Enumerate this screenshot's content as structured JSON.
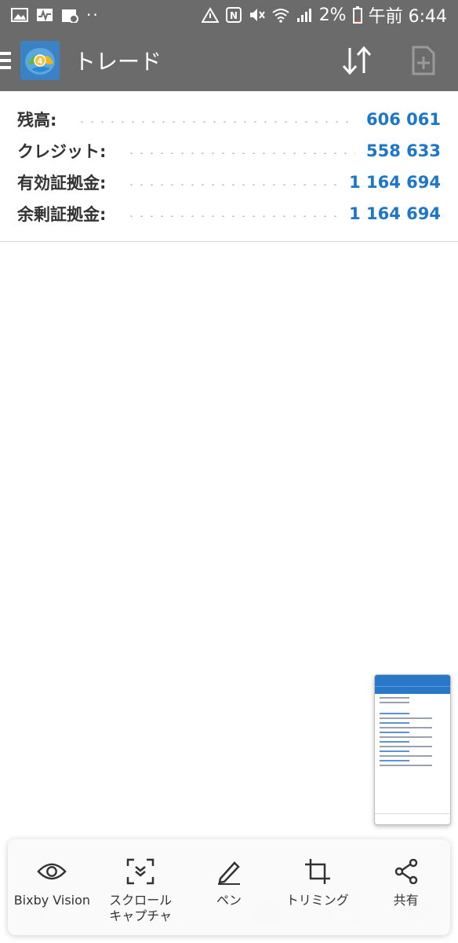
{
  "status_bar": {
    "battery": "2%",
    "time": "午前 6:44",
    "left_icons": [
      "image-icon",
      "activity-icon",
      "calendar-icon",
      "more-dots-icon"
    ],
    "right_icons": [
      "alert-icon",
      "nfc-icon",
      "mute-icon",
      "wifi-icon",
      "signal-icon",
      "battery-icon"
    ]
  },
  "app_bar": {
    "title": "トレード",
    "logo": "metatrader-4-logo",
    "actions": [
      "sort-icon",
      "new-order-icon"
    ]
  },
  "account": {
    "rows": [
      {
        "label": "残高:",
        "value": "606 061"
      },
      {
        "label": "クレジット:",
        "value": "558 633"
      },
      {
        "label": "有効証拠金:",
        "value": "1 164 694"
      },
      {
        "label": "余剰証拠金:",
        "value": "1 164 694"
      }
    ],
    "value_color": "#1c76c9"
  },
  "capture_toolbar": {
    "tools": [
      {
        "label": "Bixby Vision",
        "icon": "eye-icon"
      },
      {
        "label": "スクロール\nキャプチャ",
        "icon": "scroll-capture-icon"
      },
      {
        "label": "ペン",
        "icon": "pen-icon"
      },
      {
        "label": "トリミング",
        "icon": "crop-icon"
      },
      {
        "label": "共有",
        "icon": "share-icon"
      }
    ]
  },
  "bottom_nav": {
    "icons": [
      "quotes-icon",
      "chart-bars-icon",
      "trend-icon",
      "trade-inbox-icon",
      "news-icon",
      "chat-icon"
    ]
  },
  "colors": {
    "app_bar": "#6b6b6b",
    "accent": "#1c76c9"
  }
}
